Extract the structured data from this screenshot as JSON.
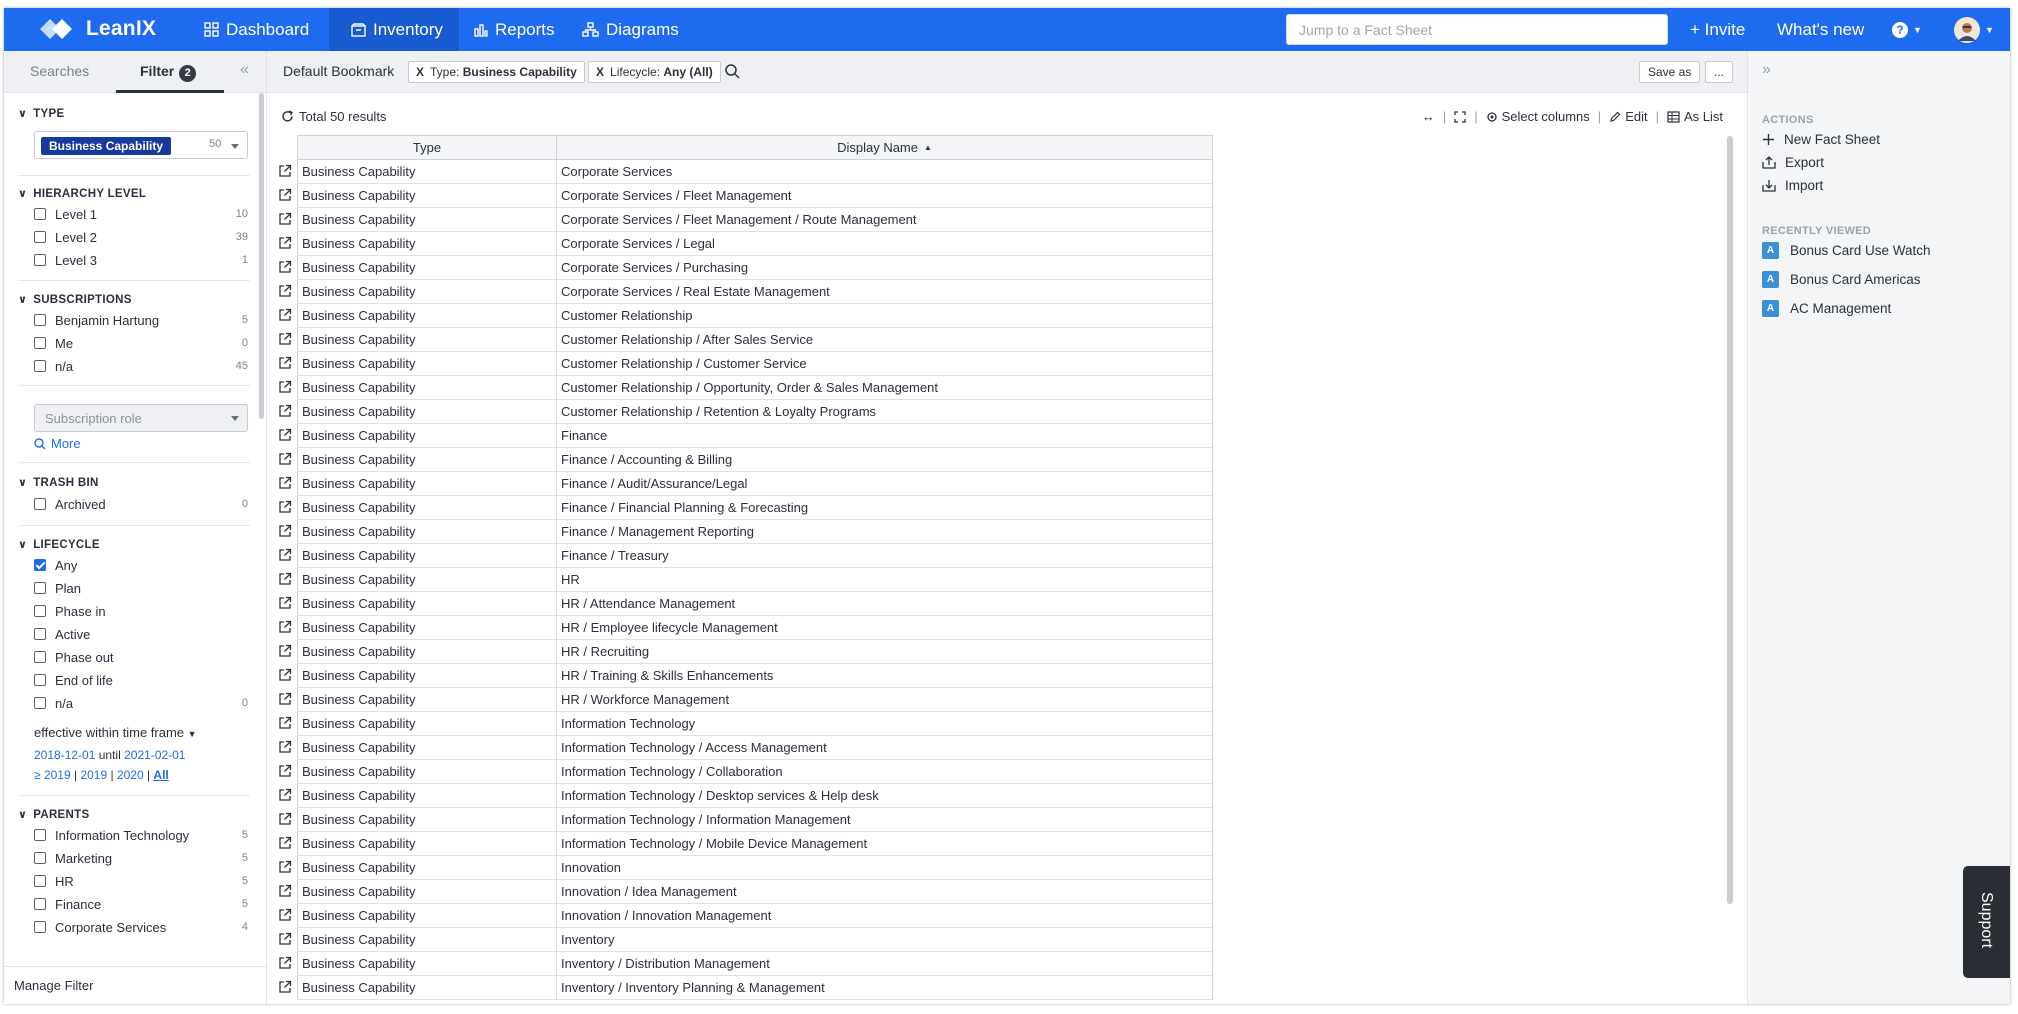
{
  "topbar": {
    "brand": "LeanIX",
    "nav": [
      {
        "label": "Dashboard",
        "icon": "grid-icon",
        "active": false
      },
      {
        "label": "Inventory",
        "icon": "inventory-icon",
        "active": true
      },
      {
        "label": "Reports",
        "icon": "bar-chart-icon",
        "active": false
      },
      {
        "label": "Diagrams",
        "icon": "diagram-icon",
        "active": false
      }
    ],
    "search_placeholder": "Jump to a Fact Sheet",
    "invite_label": "+ Invite",
    "whats_new_label": "What's new",
    "help_label": "?"
  },
  "sidebar": {
    "tab_searches": "Searches",
    "tab_filter": "Filter",
    "filter_count": "2",
    "type": {
      "title": "TYPE",
      "selected": "Business Capability",
      "count": "50"
    },
    "hierarchy": {
      "title": "HIERARCHY LEVEL",
      "items": [
        {
          "label": "Level 1",
          "count": "10"
        },
        {
          "label": "Level 2",
          "count": "39"
        },
        {
          "label": "Level 3",
          "count": "1"
        }
      ]
    },
    "subscriptions": {
      "title": "SUBSCRIPTIONS",
      "items": [
        {
          "label": "Benjamin Hartung",
          "count": "5"
        },
        {
          "label": "Me",
          "count": "0"
        },
        {
          "label": "n/a",
          "count": "45"
        }
      ],
      "role_placeholder": "Subscription role",
      "more_label": "More"
    },
    "trash": {
      "title": "TRASH BIN",
      "items": [
        {
          "label": "Archived",
          "count": "0"
        }
      ]
    },
    "lifecycle": {
      "title": "LIFECYCLE",
      "items": [
        {
          "label": "Any",
          "count": "",
          "checked": true
        },
        {
          "label": "Plan",
          "count": ""
        },
        {
          "label": "Phase in",
          "count": ""
        },
        {
          "label": "Active",
          "count": ""
        },
        {
          "label": "Phase out",
          "count": ""
        },
        {
          "label": "End of life",
          "count": ""
        },
        {
          "label": "n/a",
          "count": "0"
        }
      ],
      "timeframe_label": "effective within time frame",
      "date_from": "2018-12-01",
      "until": "until",
      "date_to": "2021-02-01",
      "ranges": [
        "≥ 2019",
        "2019",
        "2020",
        "All"
      ]
    },
    "parents": {
      "title": "PARENTS",
      "items": [
        {
          "label": "Information Technology",
          "count": "5"
        },
        {
          "label": "Marketing",
          "count": "5"
        },
        {
          "label": "HR",
          "count": "5"
        },
        {
          "label": "Finance",
          "count": "5"
        },
        {
          "label": "Corporate Services",
          "count": "4"
        }
      ]
    },
    "manage_filter": "Manage Filter"
  },
  "main": {
    "bookmark": "Default Bookmark",
    "chips": [
      {
        "x": "X",
        "prefix": "Type:",
        "value": "Business Capability"
      },
      {
        "x": "X",
        "prefix": "Lifecycle:",
        "value": "Any (All)"
      }
    ],
    "save_as": "Save as",
    "more": "...",
    "results": "Total 50 results",
    "toolbar": {
      "select_columns": "Select columns",
      "edit": "Edit",
      "as_list": "As List"
    },
    "columns": {
      "type": "Type",
      "display_name": "Display Name"
    },
    "rows": [
      {
        "type": "Business Capability",
        "name": "Corporate Services"
      },
      {
        "type": "Business Capability",
        "name": "Corporate Services / Fleet Management"
      },
      {
        "type": "Business Capability",
        "name": "Corporate Services / Fleet Management / Route Management"
      },
      {
        "type": "Business Capability",
        "name": "Corporate Services / Legal"
      },
      {
        "type": "Business Capability",
        "name": "Corporate Services / Purchasing"
      },
      {
        "type": "Business Capability",
        "name": "Corporate Services / Real Estate Management"
      },
      {
        "type": "Business Capability",
        "name": "Customer Relationship"
      },
      {
        "type": "Business Capability",
        "name": "Customer Relationship / After Sales Service"
      },
      {
        "type": "Business Capability",
        "name": "Customer Relationship / Customer Service"
      },
      {
        "type": "Business Capability",
        "name": "Customer Relationship / Opportunity, Order & Sales Management"
      },
      {
        "type": "Business Capability",
        "name": "Customer Relationship / Retention & Loyalty Programs"
      },
      {
        "type": "Business Capability",
        "name": "Finance"
      },
      {
        "type": "Business Capability",
        "name": "Finance / Accounting & Billing"
      },
      {
        "type": "Business Capability",
        "name": "Finance / Audit/Assurance/Legal"
      },
      {
        "type": "Business Capability",
        "name": "Finance / Financial Planning & Forecasting"
      },
      {
        "type": "Business Capability",
        "name": "Finance / Management Reporting"
      },
      {
        "type": "Business Capability",
        "name": "Finance / Treasury"
      },
      {
        "type": "Business Capability",
        "name": "HR"
      },
      {
        "type": "Business Capability",
        "name": "HR / Attendance Management"
      },
      {
        "type": "Business Capability",
        "name": "HR / Employee lifecycle Management"
      },
      {
        "type": "Business Capability",
        "name": "HR / Recruiting"
      },
      {
        "type": "Business Capability",
        "name": "HR / Training & Skills Enhancements"
      },
      {
        "type": "Business Capability",
        "name": "HR / Workforce Management"
      },
      {
        "type": "Business Capability",
        "name": "Information Technology"
      },
      {
        "type": "Business Capability",
        "name": "Information Technology / Access Management"
      },
      {
        "type": "Business Capability",
        "name": "Information Technology / Collaboration"
      },
      {
        "type": "Business Capability",
        "name": "Information Technology / Desktop services & Help desk"
      },
      {
        "type": "Business Capability",
        "name": "Information Technology / Information Management"
      },
      {
        "type": "Business Capability",
        "name": "Information Technology / Mobile Device Management"
      },
      {
        "type": "Business Capability",
        "name": "Innovation"
      },
      {
        "type": "Business Capability",
        "name": "Innovation / Idea Management"
      },
      {
        "type": "Business Capability",
        "name": "Innovation / Innovation Management"
      },
      {
        "type": "Business Capability",
        "name": "Inventory"
      },
      {
        "type": "Business Capability",
        "name": "Inventory / Distribution Management"
      },
      {
        "type": "Business Capability",
        "name": "Inventory / Inventory Planning & Management"
      }
    ]
  },
  "right": {
    "actions_title": "ACTIONS",
    "actions": [
      {
        "label": "New Fact Sheet",
        "icon": "plus-icon"
      },
      {
        "label": "Export",
        "icon": "export-icon"
      },
      {
        "label": "Import",
        "icon": "import-icon"
      }
    ],
    "recent_title": "RECENTLY VIEWED",
    "recent": [
      {
        "badge": "A",
        "label": "Bonus Card Use Watch"
      },
      {
        "badge": "A",
        "label": "Bonus Card Americas"
      },
      {
        "badge": "A",
        "label": "AC Management"
      }
    ],
    "support_label": "Support"
  },
  "colors": {
    "topbar": "#1f6bf0",
    "type_chip": "#163b9c",
    "badge": "#3b8fd6",
    "link": "#1f6bf0"
  }
}
